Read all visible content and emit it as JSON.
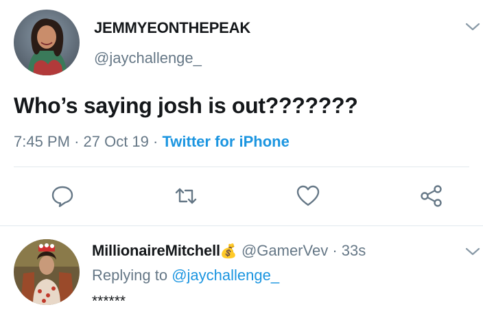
{
  "tweet": {
    "display_name": "JEMMYEONTHEPEAK",
    "handle": "@jaychallenge_",
    "text": "Who’s saying josh is out???????",
    "time": "7:45 PM",
    "sep1": "·",
    "date": "27 Oct 19",
    "sep2": "·",
    "source": "Twitter for iPhone"
  },
  "actions": [
    "reply-icon",
    "retweet-icon",
    "like-icon",
    "share-icon"
  ],
  "reply": {
    "display_name": "MillionaireMitchell",
    "emoji": "💰",
    "handle": "@GamerVev",
    "sep": "·",
    "age": "33s",
    "replying_prefix": "Replying to",
    "replying_to": "@jaychallenge_",
    "text": "******"
  },
  "colors": {
    "text": "#14171a",
    "secondary": "#657786",
    "link": "#1b95e0",
    "divider": "#e1e8ed"
  }
}
